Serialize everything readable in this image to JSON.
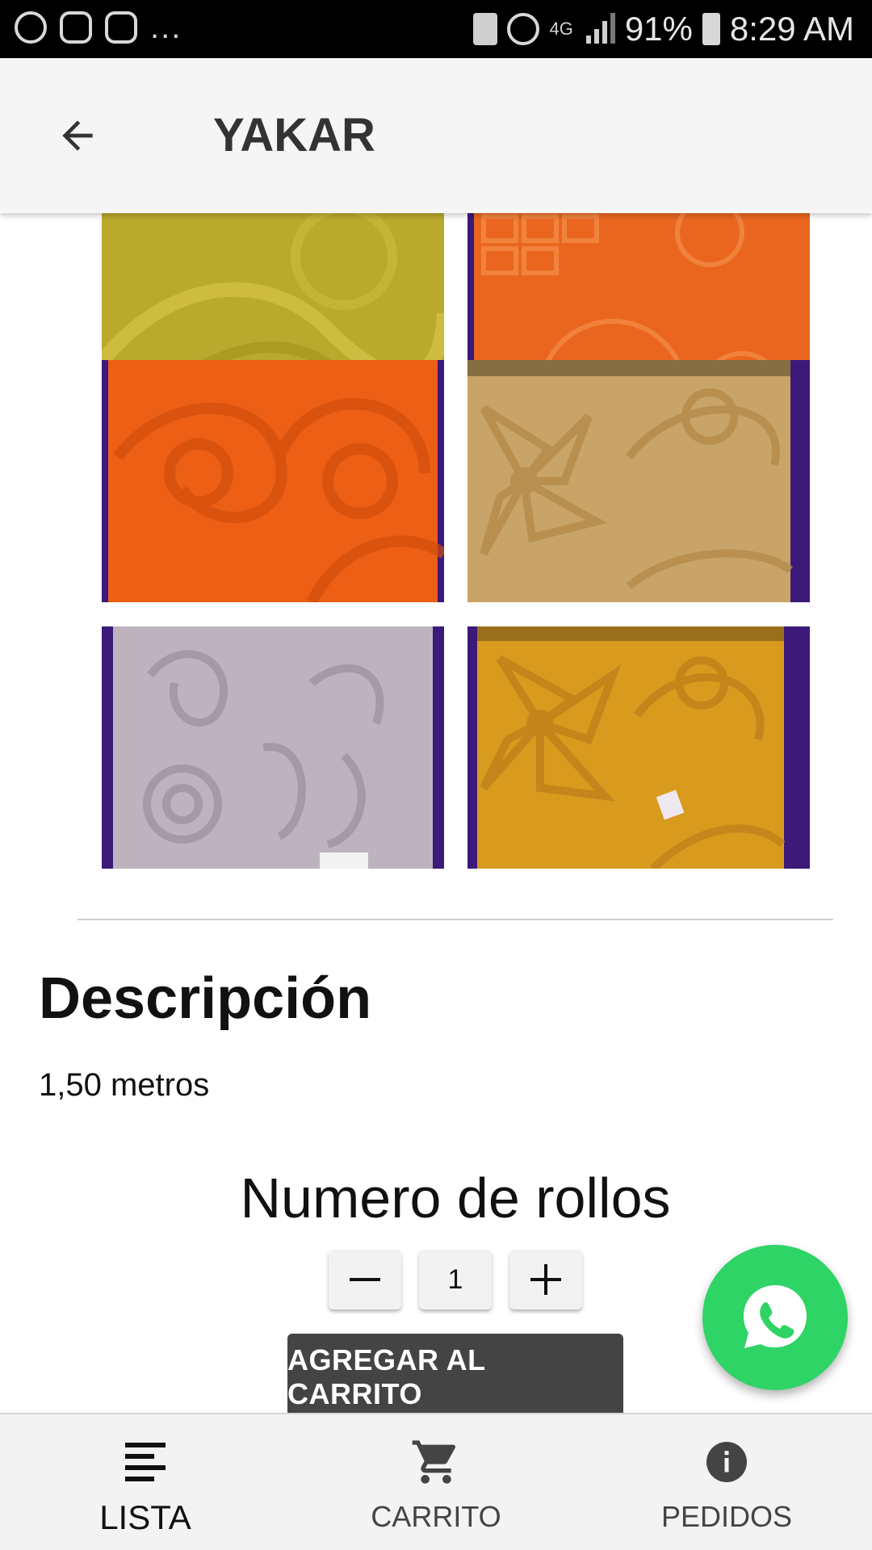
{
  "status_bar": {
    "dots": "...",
    "network": "4G",
    "battery": "91%",
    "time": "8:29 AM",
    "icons": [
      "whatsapp-icon",
      "instagram-icon",
      "instagram-icon",
      "sim-icon",
      "alarm-icon",
      "signal-icon",
      "battery-icon"
    ]
  },
  "app_bar": {
    "title": "YAKAR",
    "back_icon": "arrow-left-icon"
  },
  "gallery": {
    "images": [
      {
        "name": "fabric-yellow-swirl",
        "colors": [
          "#b6a62a",
          "#c9b83a"
        ]
      },
      {
        "name": "fabric-orange-geometric",
        "colors": [
          "#e8621e",
          "#f07c36"
        ]
      },
      {
        "name": "fabric-orange-swirl",
        "colors": [
          "#ec5e12",
          "#f47a2a"
        ]
      },
      {
        "name": "fabric-tan-floral",
        "colors": [
          "#c5a064",
          "#dcbb82"
        ]
      },
      {
        "name": "fabric-lilac-floral",
        "colors": [
          "#b7aeb9",
          "#d1c9d2"
        ]
      },
      {
        "name": "fabric-gold-floral",
        "colors": [
          "#d69a1d",
          "#e9b43a"
        ]
      }
    ]
  },
  "description": {
    "title": "Descripción",
    "text": "1,50 metros"
  },
  "quantity": {
    "label": "Numero de rollos",
    "minus": "−",
    "value": "1",
    "plus": "+"
  },
  "add_to_cart": "AGREGAR AL CARRITO",
  "fab": {
    "icon": "whatsapp-icon",
    "color": "#2ed465"
  },
  "bottom_nav": {
    "items": [
      {
        "label": "LISTA",
        "icon": "list-icon",
        "active": true
      },
      {
        "label": "CARRITO",
        "icon": "cart-icon",
        "active": false
      },
      {
        "label": "PEDIDOS",
        "icon": "info-icon",
        "active": false
      }
    ]
  }
}
